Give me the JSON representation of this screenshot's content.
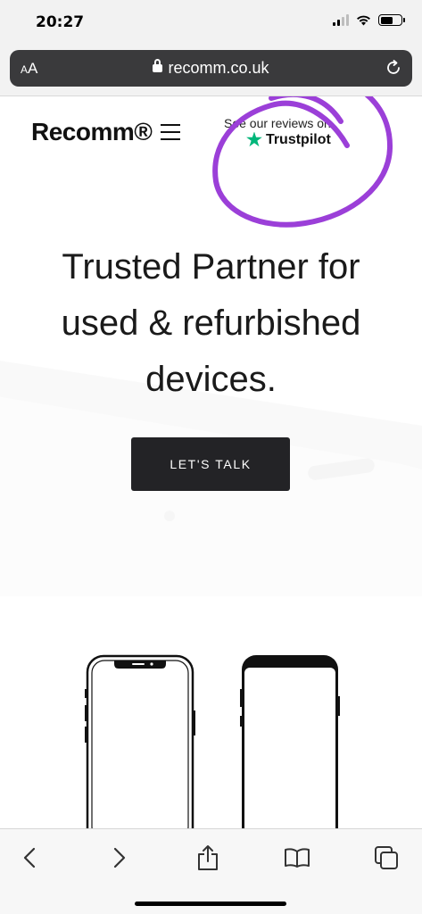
{
  "status_bar": {
    "time": "20:27",
    "signal_bars_lit": 2,
    "signal_bars_total": 4,
    "battery_level": 0.6
  },
  "browser": {
    "text_size_label_small": "A",
    "text_size_label_large": "A",
    "url": "recomm.co.uk"
  },
  "site_header": {
    "logo": "Recomm®",
    "reviews_text": "See our reviews on",
    "trustpilot_label": "Trustpilot",
    "trustpilot_star_color": "#00b67a"
  },
  "annotation": {
    "circle_color": "#9b3fd8"
  },
  "hero": {
    "lines": [
      "Trusted Partner for",
      "used & refurbished",
      "devices."
    ],
    "cta_label": "LET'S TALK"
  },
  "toolbar": {
    "items": [
      "back-icon",
      "forward-icon",
      "share-icon",
      "bookmarks-icon",
      "tabs-icon"
    ]
  }
}
